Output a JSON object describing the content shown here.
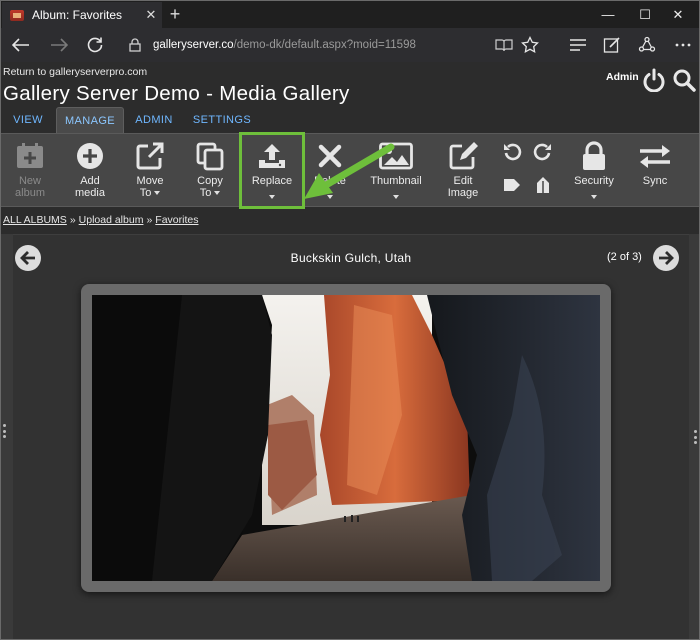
{
  "browser": {
    "tab_title": "Album: Favorites",
    "tab_close": "✕",
    "new_tab": "+",
    "url_host": "galleryserver.co",
    "url_path": "/demo-dk/default.aspx?moid=11598",
    "window_controls": {
      "minimize": "—",
      "maximize": "☐",
      "close": "✕"
    }
  },
  "header": {
    "return_link": "Return to galleryserverpro.com",
    "title": "Gallery Server Demo - Media Gallery",
    "user": "Admin"
  },
  "tabs": [
    {
      "label": "VIEW",
      "active": false
    },
    {
      "label": "MANAGE",
      "active": true
    },
    {
      "label": "ADMIN",
      "active": false
    },
    {
      "label": "SETTINGS",
      "active": false
    }
  ],
  "toolbar": {
    "new_album": {
      "line1": "New",
      "line2": "album"
    },
    "add_media": {
      "line1": "Add",
      "line2": "media"
    },
    "move_to": {
      "line1": "Move",
      "line2": "To"
    },
    "copy_to": {
      "line1": "Copy",
      "line2": "To"
    },
    "replace": {
      "line1": "Replace"
    },
    "delete": {
      "line1": "Delete"
    },
    "thumbnail": {
      "line1": "Thumbnail"
    },
    "edit_image": {
      "line1": "Edit",
      "line2": "Image"
    },
    "security": {
      "line1": "Security"
    },
    "sync": {
      "line1": "Sync"
    }
  },
  "breadcrumb": {
    "items": [
      "ALL ALBUMS",
      "Upload album",
      "Favorites"
    ],
    "separator": "»"
  },
  "viewer": {
    "title": "Buckskin Gulch, Utah",
    "counter": "(2 of 3)"
  },
  "colors": {
    "highlight": "#6ebf3b",
    "tab_link": "#6fb7ff",
    "toolbar_bg": "#474747",
    "page_bg": "#2c2c2c"
  }
}
